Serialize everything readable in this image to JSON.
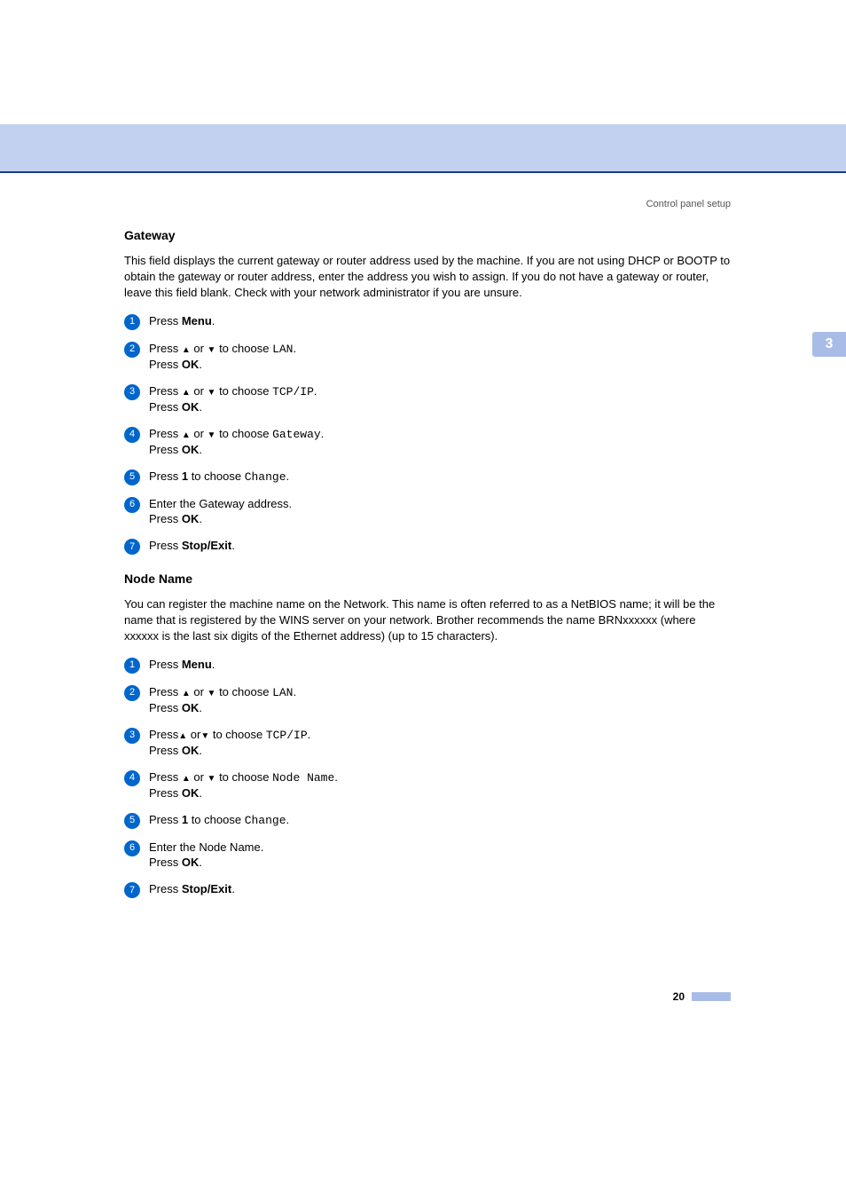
{
  "header": {
    "running_title": "Control panel setup"
  },
  "tab": {
    "chapter": "3"
  },
  "section_gateway": {
    "title": "Gateway",
    "intro": "This field displays the current gateway or router address used by the machine. If you are not using DHCP or BOOTP to obtain the gateway or router address, enter the address you wish to assign. If you do not have a gateway or router, leave this field blank. Check with your network administrator if you are unsure.",
    "steps": [
      {
        "n": "1",
        "l1a": "Press ",
        "l1b": "Menu",
        "l1c": "."
      },
      {
        "n": "2",
        "l1a": "Press ",
        "arr1": "▲",
        "mid": " or ",
        "arr2": "▼",
        "l1b": " to choose ",
        "mono": "LAN",
        "l1c": ".",
        "l2a": "Press ",
        "l2b": "OK",
        "l2c": "."
      },
      {
        "n": "3",
        "l1a": "Press ",
        "arr1": "▲",
        "mid": " or ",
        "arr2": "▼",
        "l1b": " to choose ",
        "mono": "TCP/IP",
        "l1c": ".",
        "l2a": "Press ",
        "l2b": "OK",
        "l2c": "."
      },
      {
        "n": "4",
        "l1a": "Press ",
        "arr1": "▲",
        "mid": " or ",
        "arr2": "▼",
        "l1b": " to choose ",
        "mono": "Gateway",
        "l1c": ".",
        "l2a": "Press ",
        "l2b": "OK",
        "l2c": "."
      },
      {
        "n": "5",
        "l1a": "Press ",
        "l1b": "1",
        "l1c": " to choose ",
        "mono": "Change",
        "l1d": "."
      },
      {
        "n": "6",
        "l1a": "Enter the Gateway address.",
        "l2a": "Press ",
        "l2b": "OK",
        "l2c": "."
      },
      {
        "n": "7",
        "l1a": "Press ",
        "l1b": "Stop/Exit",
        "l1c": "."
      }
    ]
  },
  "section_node": {
    "title": "Node Name",
    "intro": "You can register the machine name on the Network. This name is often referred to as a NetBIOS name; it will be the name that is registered by the WINS server on your network. Brother recommends the name BRNxxxxxx (where xxxxxx is the last six digits of the Ethernet address) (up to 15 characters).",
    "steps": [
      {
        "n": "1",
        "l1a": "Press ",
        "l1b": "Menu",
        "l1c": "."
      },
      {
        "n": "2",
        "l1a": "Press ",
        "arr1": "▲",
        "mid": " or ",
        "arr2": "▼",
        "l1b": " to choose ",
        "mono": "LAN",
        "l1c": ".",
        "l2a": "Press ",
        "l2b": "OK",
        "l2c": "."
      },
      {
        "n": "3",
        "l1a": "Press",
        "arr1": "▲",
        "mid": " or",
        "arr2": "▼",
        "l1b": " to choose ",
        "mono": "TCP/IP",
        "l1c": ".",
        "l2a": "Press ",
        "l2b": "OK",
        "l2c": "."
      },
      {
        "n": "4",
        "l1a": "Press ",
        "arr1": "▲",
        "mid": " or ",
        "arr2": "▼",
        "l1b": " to choose ",
        "mono": "Node Name",
        "l1c": ".",
        "l2a": "Press ",
        "l2b": "OK",
        "l2c": "."
      },
      {
        "n": "5",
        "l1a": "Press ",
        "l1b": "1",
        "l1c": " to choose ",
        "mono": "Change",
        "l1d": "."
      },
      {
        "n": "6",
        "l1a": "Enter the Node Name.",
        "l2a": "Press ",
        "l2b": "OK",
        "l2c": "."
      },
      {
        "n": "7",
        "l1a": "Press ",
        "l1b": "Stop/Exit",
        "l1c": "."
      }
    ]
  },
  "footer": {
    "page": "20"
  }
}
